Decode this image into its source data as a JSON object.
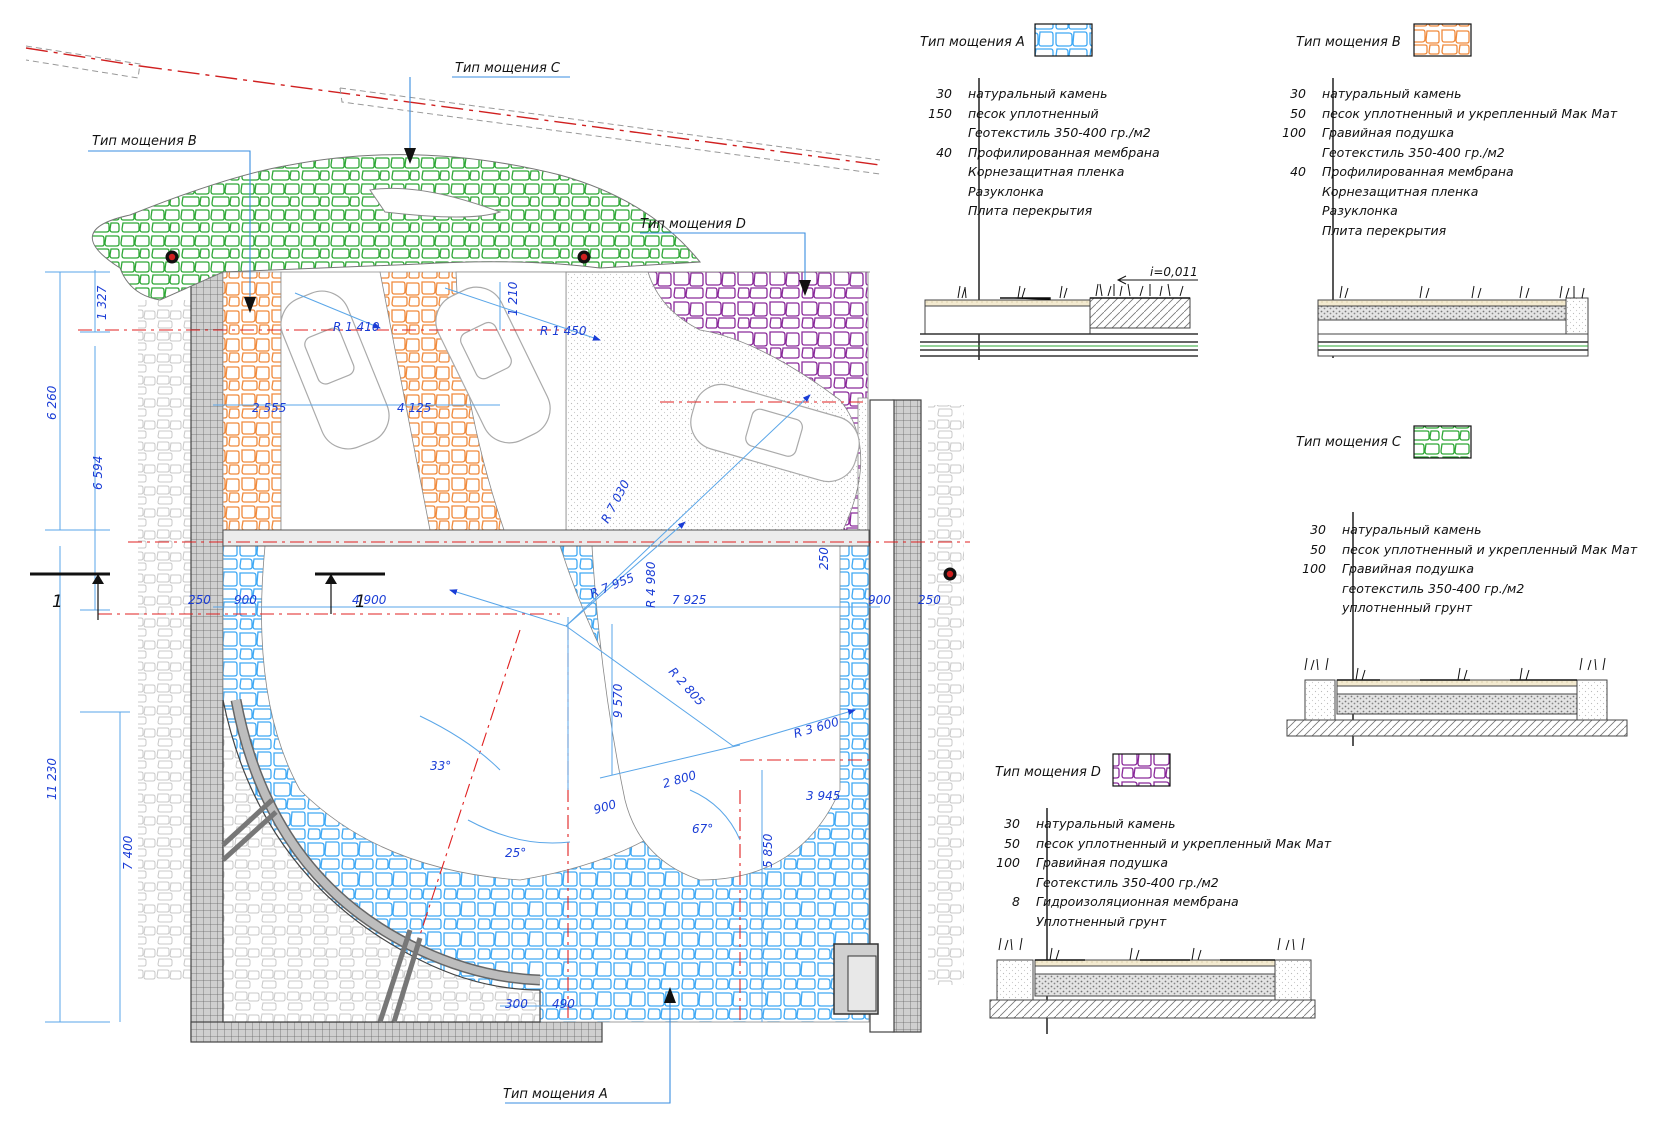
{
  "labels": {
    "type_a": "Тип мощения A",
    "type_b": "Тип мощения B",
    "type_c": "Тип мощения C",
    "type_d": "Тип мощения D",
    "section_mark": "1",
    "slope": "i=0,011"
  },
  "dimensions": {
    "r1410": "R 1 410",
    "r1450": "R 1 450",
    "r7030": "R 7 030",
    "r7955": "R 7 955",
    "r4980": "R 4 980",
    "r2805": "R 2 805",
    "r3600": "R 3 600",
    "d1327": "1 327",
    "d1210": "1 210",
    "d6260": "6 260",
    "d6594": "6 594",
    "d2555": "2 555",
    "d4125": "4 125",
    "d250a": "250",
    "d250b": "250",
    "d250c": "250",
    "d900a": "900",
    "d900b": "900",
    "d900c": "900",
    "d4900": "4 900",
    "d7925": "7 925",
    "d9570": "9 570",
    "d11230": "11 230",
    "d7400": "7 400",
    "d2800": "2 800",
    "d3945": "3 945",
    "d5850": "5 850",
    "d300": "300",
    "d490": "490",
    "a33": "33°",
    "a25": "25°",
    "a67": "67°"
  },
  "specs": {
    "a": [
      {
        "num": "30",
        "text": "натуральный камень"
      },
      {
        "num": "150",
        "text": "песок уплотненный"
      },
      {
        "num": "",
        "text": "Геотекстиль 350-400 гр./м2"
      },
      {
        "num": "40",
        "text": "Профилированная мембрана"
      },
      {
        "num": "",
        "text": "Корнезащитная пленка"
      },
      {
        "num": "",
        "text": "Разуклонка"
      },
      {
        "num": "",
        "text": "Плита перекрытия"
      }
    ],
    "b": [
      {
        "num": "30",
        "text": "натуральный камень"
      },
      {
        "num": "50",
        "text": "песок уплотненный и укрепленный Мак Мат"
      },
      {
        "num": "100",
        "text": "Гравийная подушка"
      },
      {
        "num": "",
        "text": "Геотекстиль 350-400 гр./м2"
      },
      {
        "num": "40",
        "text": "Профилированная мембрана"
      },
      {
        "num": "",
        "text": "Корнезащитная пленка"
      },
      {
        "num": "",
        "text": "Разуклонка"
      },
      {
        "num": "",
        "text": "Плита перекрытия"
      }
    ],
    "c": [
      {
        "num": "30",
        "text": "натуральный камень"
      },
      {
        "num": "50",
        "text": "песок уплотненный и укрепленный Мак Мат"
      },
      {
        "num": "100",
        "text": "Гравийная подушка"
      },
      {
        "num": "",
        "text": "геотекстиль 350-400 гр./м2"
      },
      {
        "num": "",
        "text": "уплотненный грунт"
      }
    ],
    "d": [
      {
        "num": "30",
        "text": "натуральный камень"
      },
      {
        "num": "50",
        "text": "песок уплотненный и укрепленный Мак Мат"
      },
      {
        "num": "100",
        "text": "Гравийная подушка"
      },
      {
        "num": "",
        "text": "Геотекстиль 350-400 гр./м2"
      },
      {
        "num": "8",
        "text": "Гидроизоляционная мембрана"
      },
      {
        "num": "",
        "text": "Уплотненный грунт"
      }
    ]
  },
  "colors": {
    "type_a": "#3fa9f5",
    "type_b": "#f08a3c",
    "type_c": "#2ea836",
    "type_d": "#8a2a9a",
    "dimension": "#1a3dd6",
    "axis": "#e02020"
  }
}
